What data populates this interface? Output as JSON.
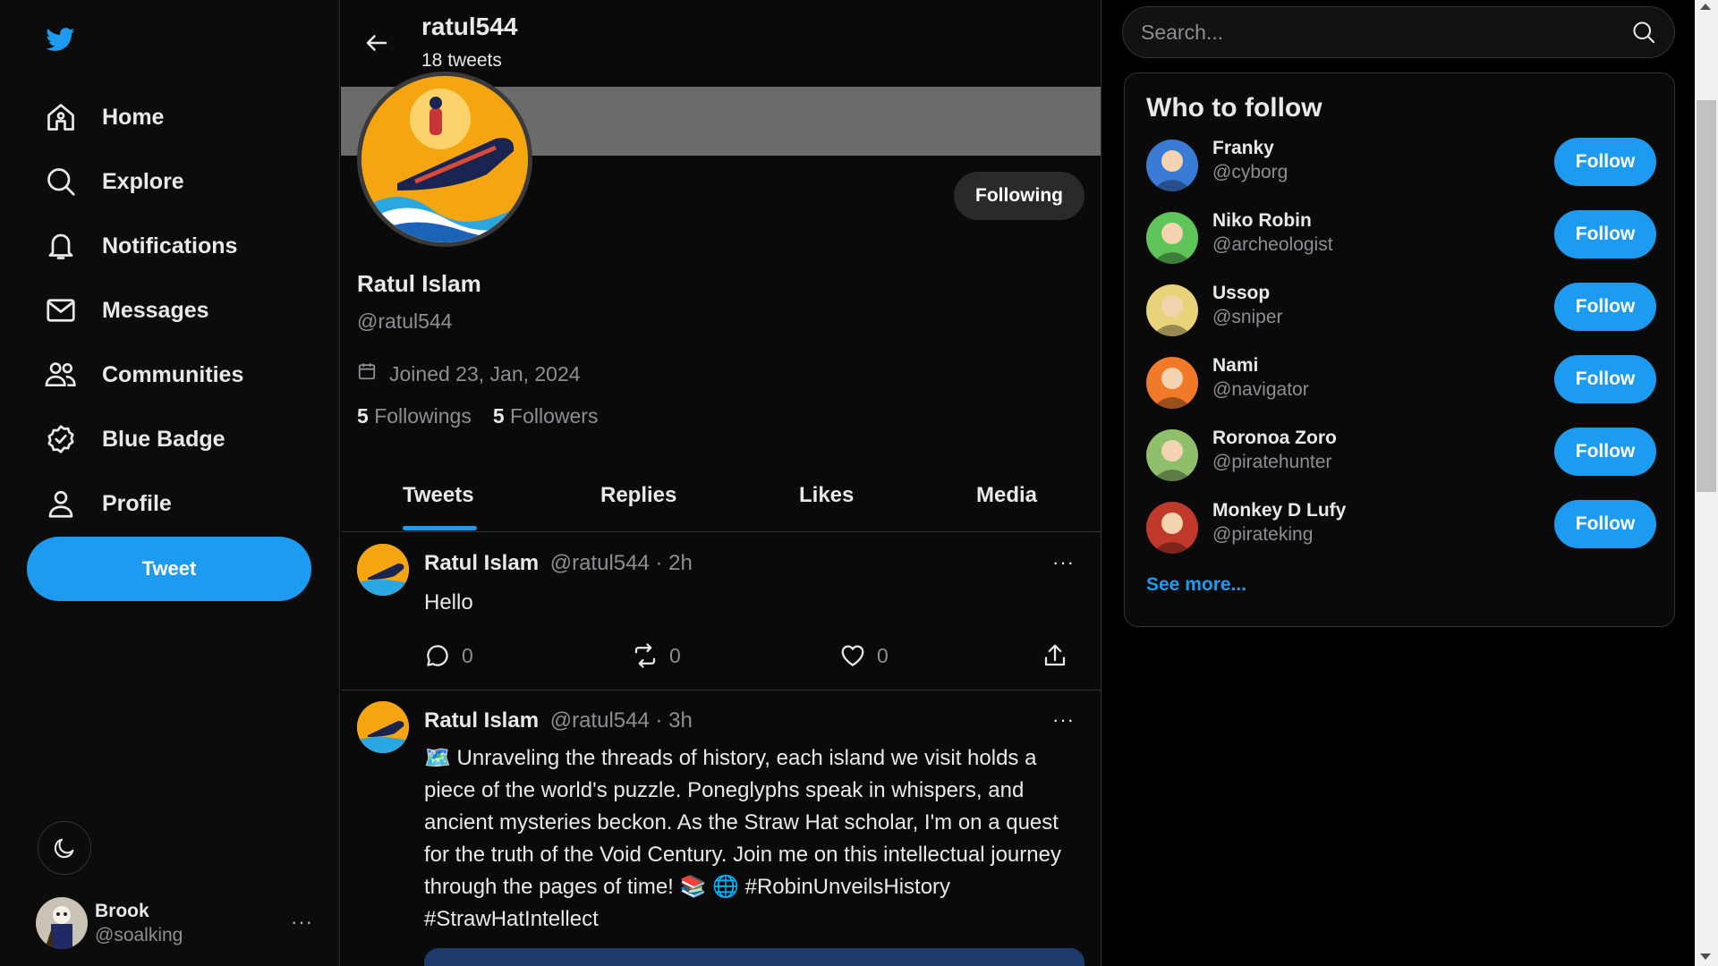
{
  "nav": {
    "items": [
      {
        "label": "Home",
        "icon": "home-icon"
      },
      {
        "label": "Explore",
        "icon": "search-icon"
      },
      {
        "label": "Notifications",
        "icon": "bell-icon"
      },
      {
        "label": "Messages",
        "icon": "mail-icon"
      },
      {
        "label": "Communities",
        "icon": "users-icon"
      },
      {
        "label": "Blue Badge",
        "icon": "badge-check-icon"
      },
      {
        "label": "Profile",
        "icon": "user-icon"
      }
    ],
    "tweet_button": "Tweet"
  },
  "account": {
    "name": "Brook",
    "handle": "@soalking",
    "more": "···"
  },
  "header": {
    "title": "ratul544",
    "subtitle": "18 tweets"
  },
  "profile": {
    "name": "Ratul Islam",
    "handle": "@ratul544",
    "joined": "Joined 23, Jan, 2024",
    "followings_count": "5",
    "followings_label": "Followings",
    "followers_count": "5",
    "followers_label": "Followers",
    "following_button": "Following"
  },
  "tabs": [
    {
      "label": "Tweets",
      "active": true
    },
    {
      "label": "Replies",
      "active": false
    },
    {
      "label": "Likes",
      "active": false
    },
    {
      "label": "Media",
      "active": false
    }
  ],
  "tweets": [
    {
      "name": "Ratul Islam",
      "handle": "@ratul544",
      "time": "· 2h",
      "text": "Hello",
      "replies": "0",
      "retweets": "0",
      "likes": "0"
    },
    {
      "name": "Ratul Islam",
      "handle": "@ratul544",
      "time": "· 3h",
      "text": "🗺️ Unraveling the threads of history, each island we visit holds a piece of the world's puzzle. Poneglyphs speak in whispers, and ancient mysteries beckon. As the Straw Hat scholar, I'm on a quest for the truth of the Void Century. Join me on this intellectual journey through the pages of time! 📚 🌐 #RobinUnveilsHistory #StrawHatIntellect"
    }
  ],
  "search": {
    "placeholder": "Search..."
  },
  "who_to_follow": {
    "title": "Who to follow",
    "follow_label": "Follow",
    "see_more": "See more...",
    "users": [
      {
        "name": "Franky",
        "handle": "@cyborg",
        "color": "#3a7bd5"
      },
      {
        "name": "Niko Robin",
        "handle": "@archeologist",
        "color": "#5fc45a"
      },
      {
        "name": "Ussop",
        "handle": "@sniper",
        "color": "#e8d27a"
      },
      {
        "name": "Nami",
        "handle": "@navigator",
        "color": "#f07a2a"
      },
      {
        "name": "Roronoa Zoro",
        "handle": "@piratehunter",
        "color": "#8fbf6a"
      },
      {
        "name": "Monkey D Lufy",
        "handle": "@pirateking",
        "color": "#c0392b"
      }
    ]
  },
  "colors": {
    "accent": "#1d9bf0",
    "background": "#000000"
  }
}
